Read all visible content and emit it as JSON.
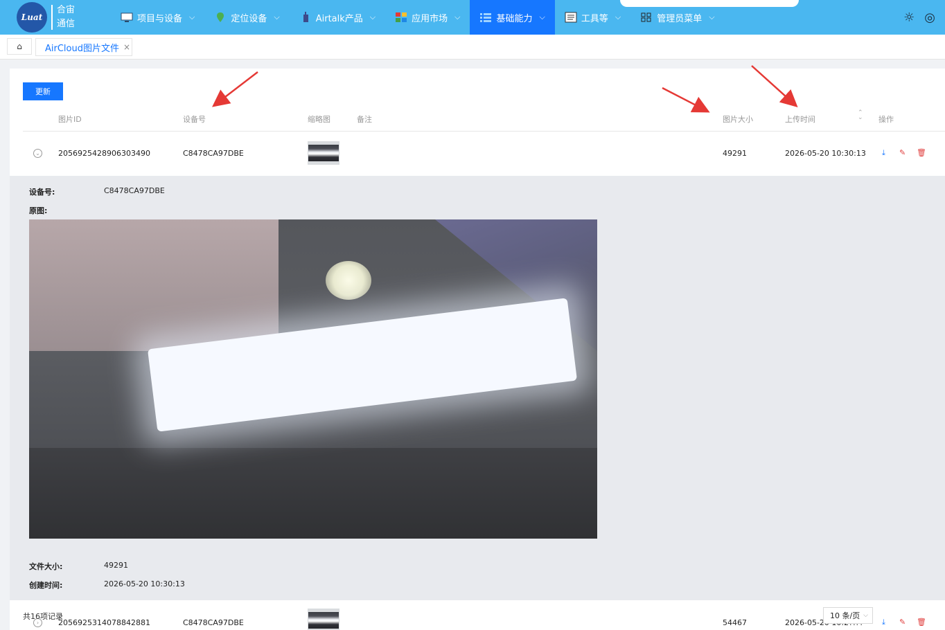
{
  "logo": {
    "mark": "Luat",
    "line1": "合宙",
    "line2": "通信"
  },
  "nav": [
    {
      "label": "项目与设备",
      "icon": "monitor-icon"
    },
    {
      "label": "定位设备",
      "icon": "map-pin-icon"
    },
    {
      "label": "Airtalk产品",
      "icon": "walkie-talkie-icon"
    },
    {
      "label": "应用市场",
      "icon": "app-grid-icon"
    },
    {
      "label": "基础能力",
      "icon": "list-icon",
      "active": true
    },
    {
      "label": "工具等",
      "icon": "document-icon"
    },
    {
      "label": "管理员菜单",
      "icon": "grid-icon"
    }
  ],
  "tabs": {
    "active_tab": "AirCloud图片文件"
  },
  "toolbar": {
    "update_label": "更新"
  },
  "table": {
    "headers": {
      "id": "图片ID",
      "device": "设备号",
      "thumb": "缩略图",
      "remark": "备注",
      "size": "图片大小",
      "time": "上传时间",
      "actions": "操作"
    },
    "rows": [
      {
        "id": "2056925428906303490",
        "device": "C8478CA97DBE",
        "size": "49291",
        "time": "2026-05-20 10:30:13"
      },
      {
        "id": "2056925314078842881",
        "device": "C8478CA97DBE",
        "size": "54467",
        "time": "2026-05-20 10:2?:??"
      }
    ]
  },
  "detail": {
    "device_label": "设备号:",
    "device_value": "C8478CA97DBE",
    "original_label": "原图:",
    "filesize_label": "文件大小:",
    "filesize_value": "49291",
    "created_label": "创建时间:",
    "created_value": "2026-05-20 10:30:13"
  },
  "pagination": {
    "total": "共16项记录",
    "page_size": "10 条/页"
  },
  "colors": {
    "nav_bg": "#4ab7f0",
    "accent": "#1677ff",
    "danger": "#e0403f",
    "annotation_arrow": "#e53935"
  }
}
